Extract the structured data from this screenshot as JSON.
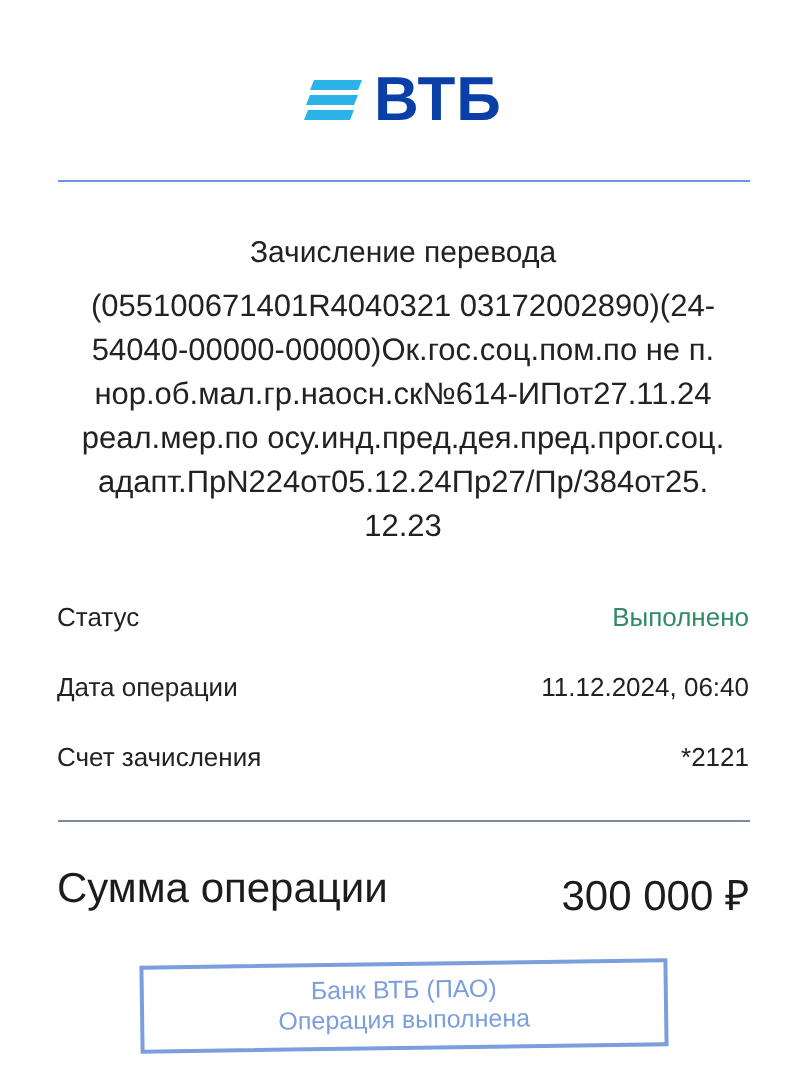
{
  "logo": {
    "text": "ВТБ"
  },
  "title": "Зачисление перевода",
  "description_lines": [
    "(055100671401R4040321 03172002890)(24-",
    "54040-00000-00000)Ок.гос.соц.пом.по не п.",
    "нор.об.мал.гр.наосн.ск№614-ИПот27.11.24",
    "реал.мер.по осу.инд.пред.дея.пред.прог.соц.",
    "адапт.ПрN224от05.12.24Пр27/Пр/384от25.",
    "12.23"
  ],
  "details": [
    {
      "label": "Статус",
      "value": "Выполнено",
      "kind": "status"
    },
    {
      "label": "Дата операции",
      "value": "11.12.2024, 06:40",
      "kind": "plain"
    },
    {
      "label": "Счет зачисления",
      "value": "*2121",
      "kind": "plain"
    }
  ],
  "total": {
    "label": "Сумма операции",
    "value": "300 000 ₽"
  },
  "stamp": {
    "lines": [
      "Банк ВТБ (ПАО)",
      "Операция выполнена"
    ]
  }
}
